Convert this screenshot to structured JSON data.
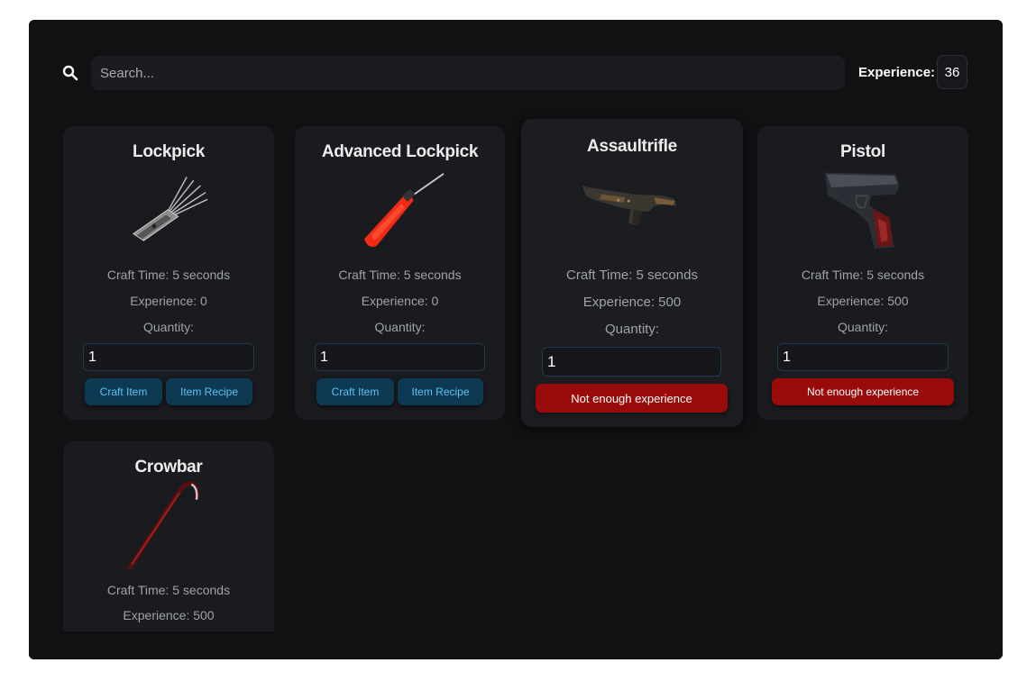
{
  "search": {
    "placeholder": "Search..."
  },
  "experience": {
    "label": "Experience:",
    "value": "36"
  },
  "cards": [
    {
      "title": "Lockpick",
      "craft_time": "Craft Time: 5 seconds",
      "experience": "Experience: 0",
      "quantity_label": "Quantity:",
      "quantity": "1",
      "buttons": [
        "Craft Item",
        "Item Recipe"
      ]
    },
    {
      "title": "Advanced Lockpick",
      "craft_time": "Craft Time: 5 seconds",
      "experience": "Experience: 0",
      "quantity_label": "Quantity:",
      "quantity": "1",
      "buttons": [
        "Craft Item",
        "Item Recipe"
      ]
    },
    {
      "title": "Assaultrifle",
      "craft_time": "Craft Time: 5 seconds",
      "experience": "Experience: 500",
      "quantity_label": "Quantity:",
      "quantity": "1",
      "status_button": "Not enough experience"
    },
    {
      "title": "Pistol",
      "craft_time": "Craft Time: 5 seconds",
      "experience": "Experience: 500",
      "quantity_label": "Quantity:",
      "quantity": "1",
      "status_button": "Not enough experience"
    },
    {
      "title": "Crowbar",
      "craft_time": "Craft Time: 5 seconds",
      "experience": "Experience: 500"
    }
  ],
  "colors": {
    "panel": "#111113",
    "card": "#1a1b1f",
    "accent_blue": "#5dc1f1",
    "button_blue": "#0d3a52",
    "button_red": "#990a0a"
  },
  "icons": [
    "search-icon",
    "lockpick-icon",
    "advanced-lockpick-icon",
    "assaultrifle-icon",
    "pistol-icon",
    "crowbar-icon"
  ]
}
